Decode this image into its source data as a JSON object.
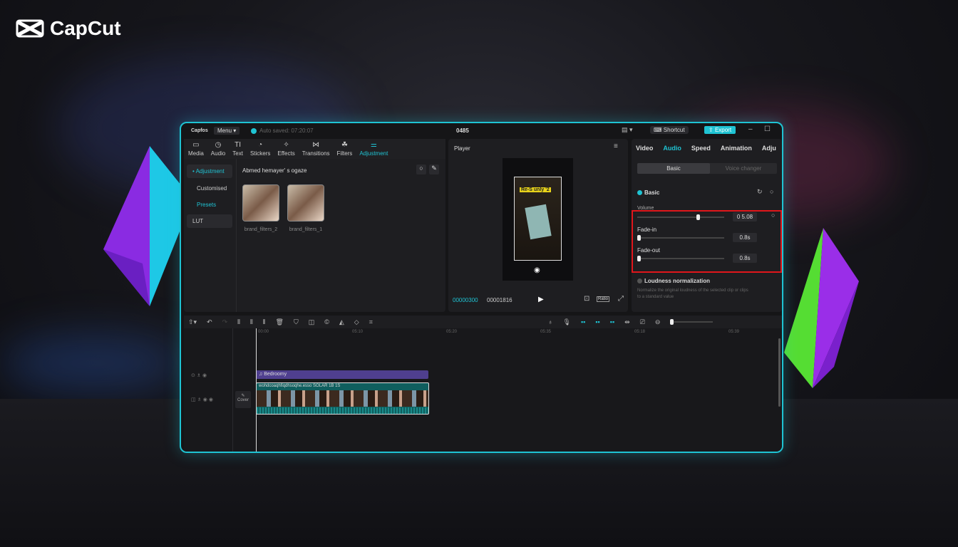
{
  "brand": {
    "name": "CapCut"
  },
  "titlebar": {
    "app": "Capfos",
    "menu": "Menu",
    "autosave": "Auto saved: 07:20:07",
    "project": "0485",
    "shortcut": "Shortcut",
    "export": "Export"
  },
  "media_tabs": [
    {
      "label": "Media",
      "icon": "media-icon"
    },
    {
      "label": "Audio",
      "icon": "audio-icon"
    },
    {
      "label": "Text",
      "icon": "text-icon"
    },
    {
      "label": "Stickers",
      "icon": "stickers-icon"
    },
    {
      "label": "Effects",
      "icon": "effects-icon"
    },
    {
      "label": "Transitions",
      "icon": "transitions-icon"
    },
    {
      "label": "Filters",
      "icon": "filters-icon"
    },
    {
      "label": "Adjustment",
      "icon": "adjustment-icon",
      "active": true
    }
  ],
  "sidebar": {
    "items": [
      {
        "label": "• Adjustment",
        "active": true
      },
      {
        "label": "Customised"
      },
      {
        "label": "Presets"
      },
      {
        "label": "LUT"
      }
    ]
  },
  "library": {
    "heading": "Abmed hemayer' s ogaze",
    "items": [
      {
        "label": "brand_filters_2"
      },
      {
        "label": "brand_filters_1"
      }
    ]
  },
  "player": {
    "title": "Player",
    "caption": "Re-S unly '2",
    "current_time": "00000300",
    "total_time": "00001816",
    "ratio": "Ratio"
  },
  "inspector": {
    "tabs": [
      "Video",
      "Audio",
      "Speed",
      "Animation",
      "Adju"
    ],
    "active_tab": "Audio",
    "subtabs": [
      "Basic",
      "Voice changer"
    ],
    "section": "Basic",
    "volume": {
      "label": "Volume",
      "value": "0 5.08",
      "level": 0.68
    },
    "fade_in": {
      "label": "Fade-in",
      "value": "0.8s",
      "level": 0
    },
    "fade_out": {
      "label": "Fade-out",
      "value": "0.8s",
      "level": 0
    },
    "normalization": {
      "label": "Loudness normalization",
      "desc1": "Normalize the original loudness of the selected clip or clips",
      "desc2": "to a standard value"
    }
  },
  "timeline": {
    "ruler": [
      "00:00",
      "05:10",
      "05:20",
      "05:35",
      "05:18",
      "05:39"
    ],
    "audio_clip": "Bedroomy",
    "video_clip": "wohdcoaqhfiqdhsoqhe.esso   SOLAR 1B 1S",
    "cover": "Cover"
  },
  "colors": {
    "accent": "#1fc3d3",
    "highlight": "#e0161b",
    "audio_clip": "#4f3f8f",
    "video_clip": "#0f5e5e"
  }
}
